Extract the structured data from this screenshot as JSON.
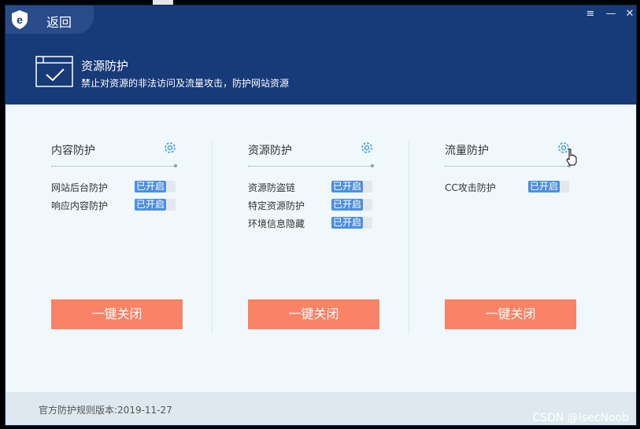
{
  "header": {
    "back_label": "返回",
    "title": "资源防护",
    "subtitle": "禁止对资源的非法访问及流量攻击，防护网站资源"
  },
  "window_controls": {
    "menu_icon": "≡",
    "minimize_icon": "—",
    "close_icon": "✕"
  },
  "panels": [
    {
      "title": "内容防护",
      "items": [
        {
          "label": "网站后台防护",
          "status": "已开启"
        },
        {
          "label": "响应内容防护",
          "status": "已开启"
        }
      ],
      "button": "一键关闭"
    },
    {
      "title": "资源防护",
      "items": [
        {
          "label": "资源防盗链",
          "status": "已开启"
        },
        {
          "label": "特定资源防护",
          "status": "已开启"
        },
        {
          "label": "环境信息隐藏",
          "status": "已开启"
        }
      ],
      "button": "一键关闭"
    },
    {
      "title": "流量防护",
      "items": [
        {
          "label": "CC攻击防护",
          "status": "已开启"
        }
      ],
      "button": "一键关闭"
    }
  ],
  "footer": {
    "version": "官方防护规则版本:2019-11-27"
  },
  "watermark": "CSDN @IsecNoob",
  "colors": {
    "header_bg": "#173a78",
    "toggle_on": "#4d8fe0",
    "button": "#fa8267",
    "content_bg": "#f1f8fb"
  }
}
